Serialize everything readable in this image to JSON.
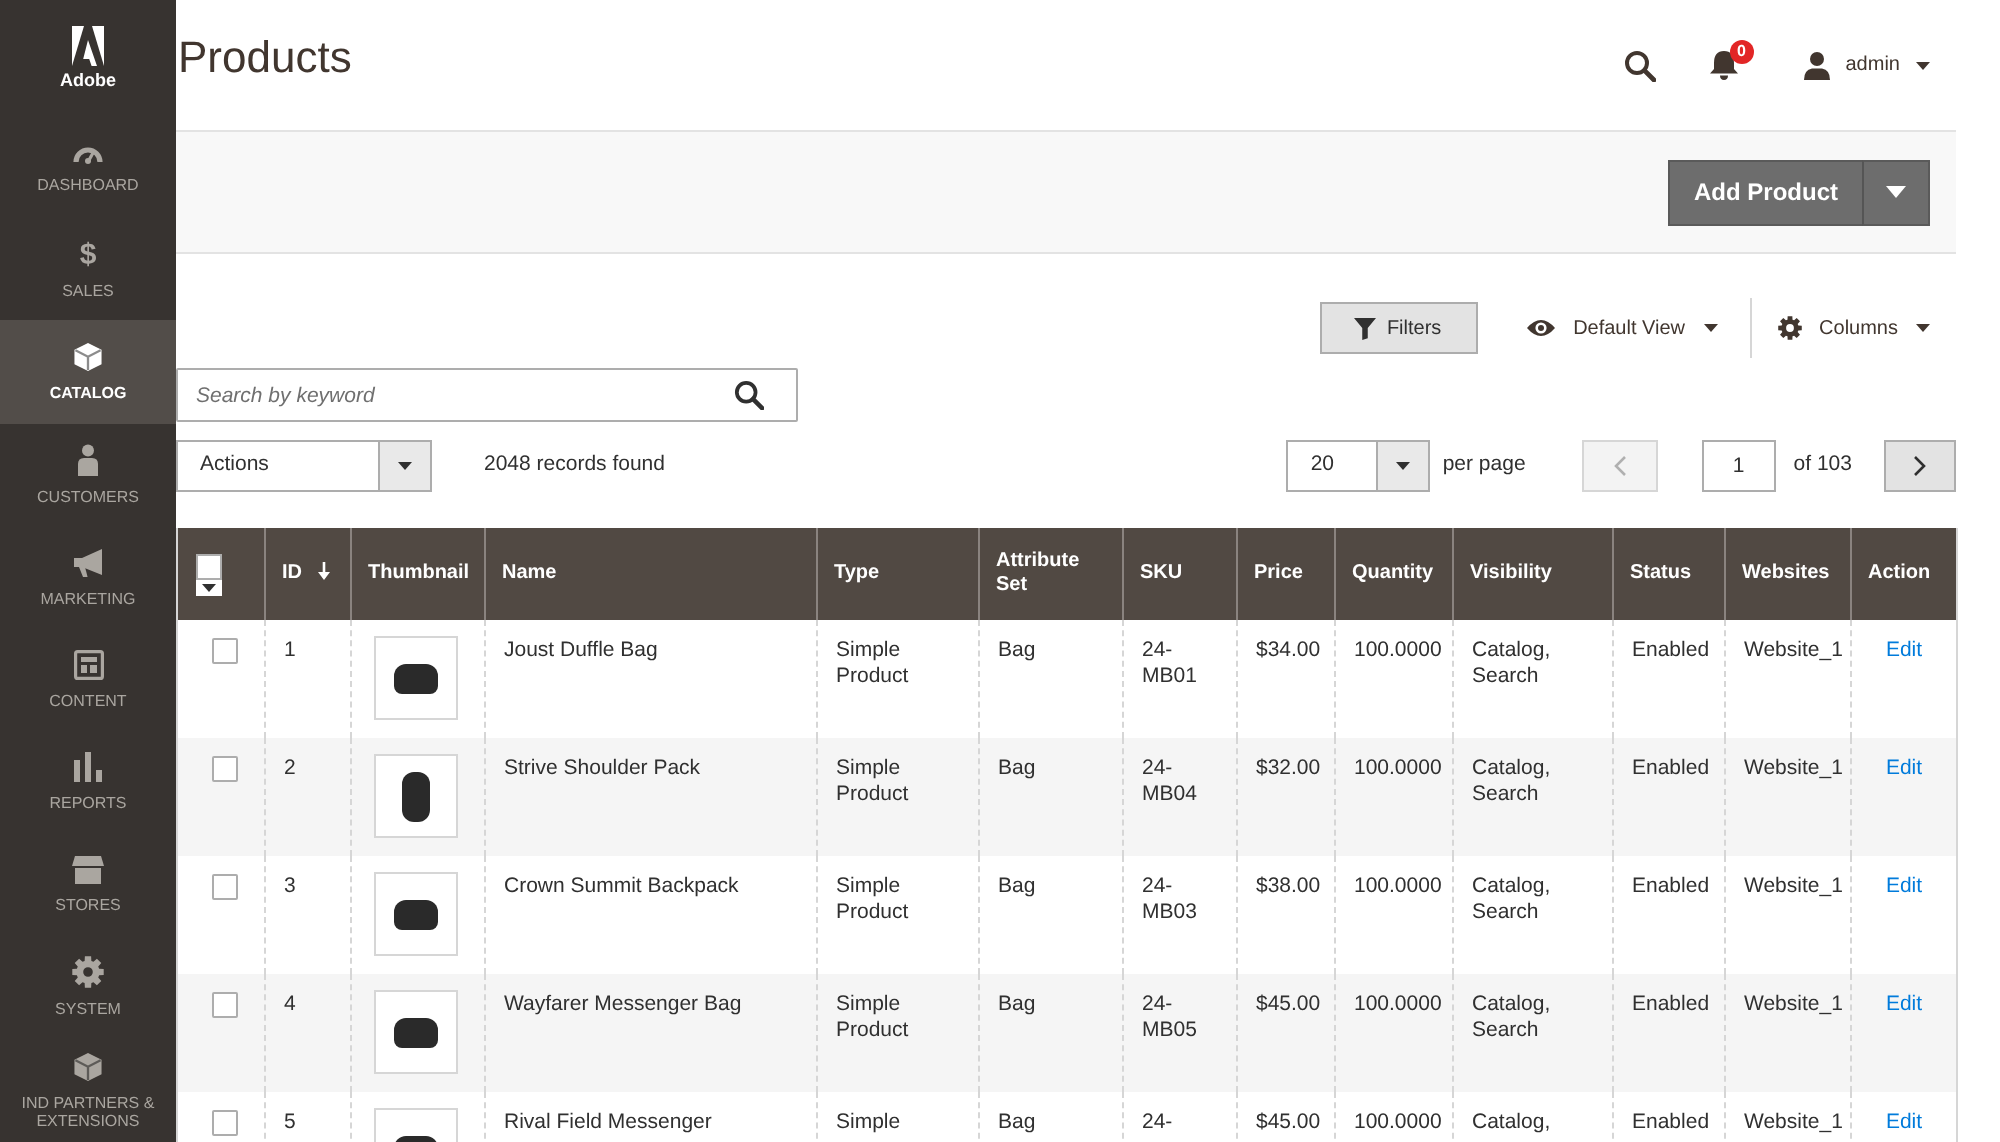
{
  "sidebar": {
    "logo": {
      "text": "Adobe"
    },
    "items": [
      {
        "label": "DASHBOARD",
        "selected": false
      },
      {
        "label": "SALES",
        "glyph": "$",
        "selected": false
      },
      {
        "label": "CATALOG",
        "selected": true
      },
      {
        "label": "CUSTOMERS",
        "selected": false
      },
      {
        "label": "MARKETING",
        "selected": false
      },
      {
        "label": "CONTENT",
        "selected": false
      },
      {
        "label": "REPORTS",
        "selected": false
      },
      {
        "label": "STORES",
        "selected": false
      },
      {
        "label": "SYSTEM",
        "selected": false
      },
      {
        "label": "IND PARTNERS & EXTENSIONS",
        "selected": false
      }
    ]
  },
  "header": {
    "title": "Products",
    "notifications": {
      "count": "0"
    },
    "user": {
      "label": "admin"
    }
  },
  "page_actions": {
    "primary_button": {
      "label": "Add Product"
    }
  },
  "toolbar": {
    "filters_button": {
      "label": "Filters"
    },
    "view": {
      "label": "Default View"
    },
    "columns": {
      "label": "Columns"
    }
  },
  "search": {
    "placeholder": "Search by keyword"
  },
  "actions_select": {
    "value": "Actions"
  },
  "records_found": "2048 records found",
  "pagination": {
    "per_page": {
      "value": "20"
    },
    "per_page_label": "per page",
    "prev": {
      "disabled": true
    },
    "page": {
      "value": "1"
    },
    "total": "of 103",
    "next": {
      "disabled": false
    }
  },
  "table": {
    "select_all": {
      "checked": false
    },
    "columns": [
      {
        "label": "ID",
        "sorted": true
      },
      {
        "label": "Thumbnail",
        "sorted": false
      },
      {
        "label": "Name",
        "sorted": false
      },
      {
        "label": "Type",
        "sorted": false
      },
      {
        "label": "Attribute Set",
        "sorted": false
      },
      {
        "label": "SKU",
        "sorted": false
      },
      {
        "label": "Price",
        "sorted": false
      },
      {
        "label": "Quantity",
        "sorted": false
      },
      {
        "label": "Visibility",
        "sorted": false
      },
      {
        "label": "Status",
        "sorted": false
      },
      {
        "label": "Websites",
        "sorted": false
      },
      {
        "label": "Action",
        "sorted": false
      }
    ],
    "rows": [
      {
        "checked": false,
        "id": "1",
        "name": "Joust Duffle Bag",
        "type": "Simple Product",
        "attribute_set": "Bag",
        "sku": "24-MB01",
        "price": "$34.00",
        "quantity": "100.0000",
        "visibility": "Catalog, Search",
        "status": "Enabled",
        "websites": "Website_1",
        "action": "Edit"
      },
      {
        "checked": false,
        "id": "2",
        "name": "Strive Shoulder Pack",
        "type": "Simple Product",
        "attribute_set": "Bag",
        "sku": "24-MB04",
        "price": "$32.00",
        "quantity": "100.0000",
        "visibility": "Catalog, Search",
        "status": "Enabled",
        "websites": "Website_1",
        "action": "Edit"
      },
      {
        "checked": false,
        "id": "3",
        "name": "Crown Summit Backpack",
        "type": "Simple Product",
        "attribute_set": "Bag",
        "sku": "24-MB03",
        "price": "$38.00",
        "quantity": "100.0000",
        "visibility": "Catalog, Search",
        "status": "Enabled",
        "websites": "Website_1",
        "action": "Edit"
      },
      {
        "checked": false,
        "id": "4",
        "name": "Wayfarer Messenger Bag",
        "type": "Simple Product",
        "attribute_set": "Bag",
        "sku": "24-MB05",
        "price": "$45.00",
        "quantity": "100.0000",
        "visibility": "Catalog, Search",
        "status": "Enabled",
        "websites": "Website_1",
        "action": "Edit"
      },
      {
        "checked": false,
        "id": "5",
        "name": "Rival Field Messenger",
        "type": "Simple",
        "attribute_set": "Bag",
        "sku": "24-",
        "price": "$45.00",
        "quantity": "100.0000",
        "visibility": "Catalog,",
        "status": "Enabled",
        "websites": "Website_1",
        "action": "Edit"
      }
    ]
  }
}
